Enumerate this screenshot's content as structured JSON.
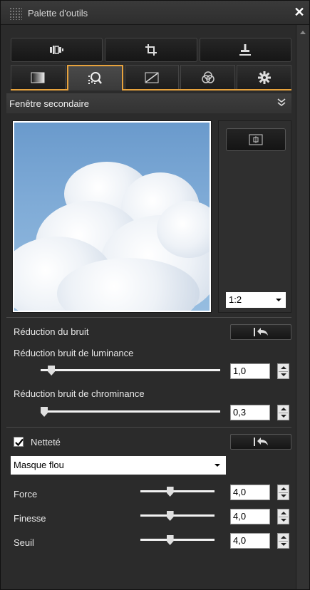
{
  "window": {
    "title": "Palette d'outils",
    "close_label": "✕"
  },
  "toolbar": {
    "buttons": [
      {
        "icon": "crop-compare-icon"
      },
      {
        "icon": "crop-icon"
      },
      {
        "icon": "stamp-icon"
      }
    ]
  },
  "tabs": [
    {
      "icon": "basic-adjust-icon",
      "active": false
    },
    {
      "icon": "noise-reduction-icon",
      "active": true
    },
    {
      "icon": "tone-curve-icon",
      "active": false
    },
    {
      "icon": "color-adjust-icon",
      "active": false
    },
    {
      "icon": "settings-gear-icon",
      "active": false
    }
  ],
  "accent_color": "#e8a33d",
  "secondary_window": {
    "title": "Fenêtre secondaire",
    "zoom": "1:2"
  },
  "noise_reduction": {
    "title": "Réduction du bruit",
    "luminance": {
      "label": "Réduction bruit de luminance",
      "value": "1,0",
      "level": 0.06
    },
    "chrominance": {
      "label": "Réduction bruit de chrominance",
      "value": "0,3",
      "level": 0.02
    }
  },
  "sharpness": {
    "label": "Netteté",
    "checked": true,
    "mode": "Masque flou",
    "force": {
      "label": "Force",
      "value": "4,0",
      "level": 0.4
    },
    "finesse": {
      "label": "Finesse",
      "value": "4,0",
      "level": 0.4
    },
    "seuil": {
      "label": "Seuil",
      "value": "4,0",
      "level": 0.4
    }
  }
}
